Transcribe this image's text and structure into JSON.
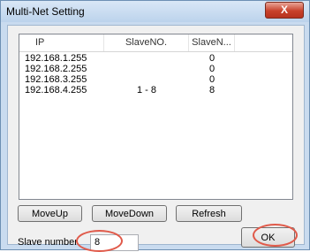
{
  "window": {
    "title": "Multi-Net Setting",
    "close_label": "X"
  },
  "list": {
    "headers": [
      "IP",
      "SlaveNO.",
      "SlaveN..."
    ],
    "rows": [
      {
        "ip": "192.168.1.255",
        "slave_no": "",
        "slave_count": "0"
      },
      {
        "ip": "192.168.2.255",
        "slave_no": "",
        "slave_count": "0"
      },
      {
        "ip": "192.168.3.255",
        "slave_no": "",
        "slave_count": "0"
      },
      {
        "ip": "192.168.4.255",
        "slave_no": "1 - 8",
        "slave_count": "8"
      }
    ]
  },
  "buttons": {
    "move_up": "MoveUp",
    "move_down": "MoveDown",
    "refresh": "Refresh",
    "ok": "OK"
  },
  "slave_number": {
    "label": "Slave number",
    "value": "8"
  },
  "colors": {
    "highlight_circle": "#e05a4a",
    "title_bar": "#c9dbef"
  }
}
